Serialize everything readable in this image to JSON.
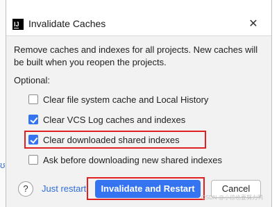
{
  "background": {
    "fragment_text": "ʊ"
  },
  "dialog": {
    "app_icon_text": "IJ",
    "title": "Invalidate Caches",
    "close_glyph": "✕",
    "description": "Remove caches and indexes for all projects. New caches will be built when you reopen the projects.",
    "optional_label": "Optional:",
    "options": [
      {
        "label": "Clear file system cache and Local History",
        "checked": false
      },
      {
        "label": "Clear VCS Log caches and indexes",
        "checked": true
      },
      {
        "label": "Clear downloaded shared indexes",
        "checked": true
      },
      {
        "label": "Ask before downloading new shared indexes",
        "checked": false
      }
    ],
    "help_glyph": "?",
    "just_restart_label": "Just restart",
    "primary_label": "Invalidate and Restart",
    "cancel_label": "Cancel"
  },
  "watermark": "CSDN @小徐也要努力鸭",
  "colors": {
    "accent": "#3574f0",
    "link": "#2f6bd8",
    "highlight": "#e02020"
  }
}
